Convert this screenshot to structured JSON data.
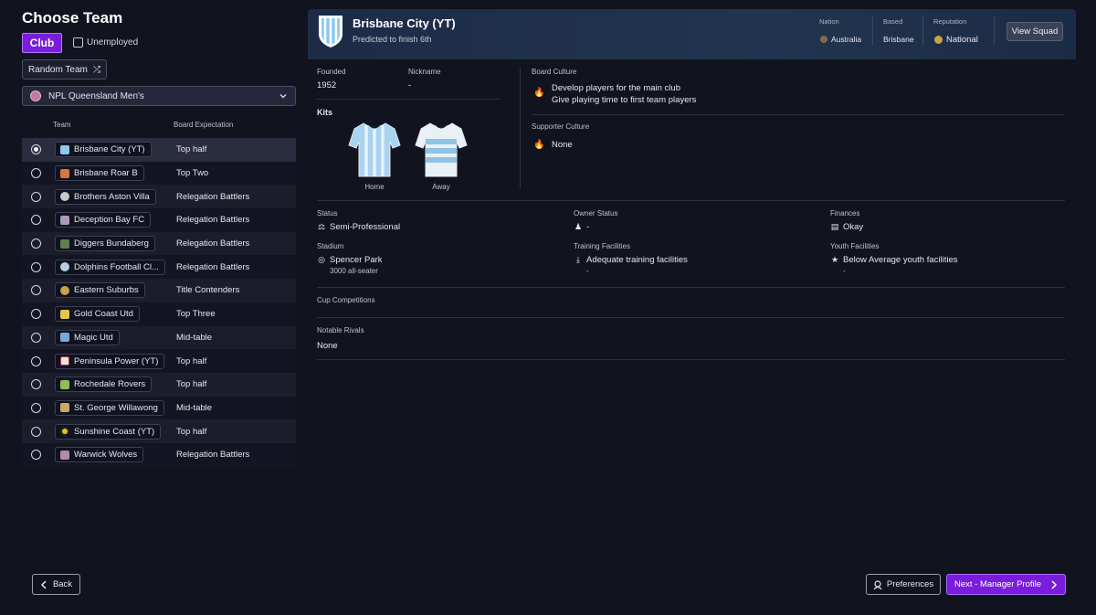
{
  "page": {
    "title": "Choose Team"
  },
  "filters": {
    "club_label": "Club",
    "unemployed_label": "Unemployed",
    "random_team_label": "Random Team",
    "league_selected": "NPL Queensland Men's"
  },
  "table": {
    "col_team": "Team",
    "col_expectation": "Board Expectation",
    "rows": [
      {
        "team": "Brisbane City (YT)",
        "expectation": "Top half",
        "selected": true
      },
      {
        "team": "Brisbane Roar B",
        "expectation": "Top Two",
        "selected": false
      },
      {
        "team": "Brothers Aston Villa",
        "expectation": "Relegation Battlers",
        "selected": false
      },
      {
        "team": "Deception Bay FC",
        "expectation": "Relegation Battlers",
        "selected": false
      },
      {
        "team": "Diggers Bundaberg",
        "expectation": "Relegation Battlers",
        "selected": false
      },
      {
        "team": "Dolphins Football Cl...",
        "expectation": "Relegation Battlers",
        "selected": false
      },
      {
        "team": "Eastern Suburbs",
        "expectation": "Title Contenders",
        "selected": false
      },
      {
        "team": "Gold Coast Utd",
        "expectation": "Top Three",
        "selected": false
      },
      {
        "team": "Magic Utd",
        "expectation": "Mid-table",
        "selected": false
      },
      {
        "team": "Peninsula Power (YT)",
        "expectation": "Top half",
        "selected": false
      },
      {
        "team": "Rochedale Rovers",
        "expectation": "Top half",
        "selected": false
      },
      {
        "team": "St. George Willawong",
        "expectation": "Mid-table",
        "selected": false
      },
      {
        "team": "Sunshine Coast  (YT)",
        "expectation": "Top half",
        "selected": false
      },
      {
        "team": "Warwick Wolves",
        "expectation": "Relegation Battlers",
        "selected": false
      }
    ]
  },
  "club": {
    "name": "Brisbane City (YT)",
    "prediction": "Predicted to finish 6th",
    "nation_label": "Nation",
    "nation": "Australia",
    "based_label": "Based",
    "based": "Brisbane",
    "reputation_label": "Reputation",
    "reputation": "National",
    "view_squad": "View Squad",
    "founded_label": "Founded",
    "founded": "1952",
    "nickname_label": "Nickname",
    "nickname": "-",
    "kits_label": "Kits",
    "kit_home": "Home",
    "kit_away": "Away",
    "board_culture_label": "Board Culture",
    "board_culture": [
      "Develop players for the main club",
      "Give playing time to first team players"
    ],
    "supporter_culture_label": "Supporter Culture",
    "supporter_culture": "None",
    "status_label": "Status",
    "status": "Semi-Professional",
    "owner_status_label": "Owner Status",
    "owner_status": "-",
    "finances_label": "Finances",
    "finances": "Okay",
    "stadium_label": "Stadium",
    "stadium": "Spencer Park",
    "stadium_sub": "3000 all-seater",
    "training_label": "Training Facilities",
    "training": "Adequate training facilities",
    "training_sub": "-",
    "youth_label": "Youth Facilities",
    "youth": "Below Average youth facilities",
    "youth_sub": "-",
    "cup_label": "Cup Competitions",
    "rivals_label": "Notable Rivals",
    "rivals": "None"
  },
  "footer": {
    "back": "Back",
    "preferences": "Preferences",
    "next": "Next - Manager Profile"
  },
  "colors": {
    "accent": "#7a1cdc",
    "header_band": "#22344f",
    "background": "#11131f"
  }
}
